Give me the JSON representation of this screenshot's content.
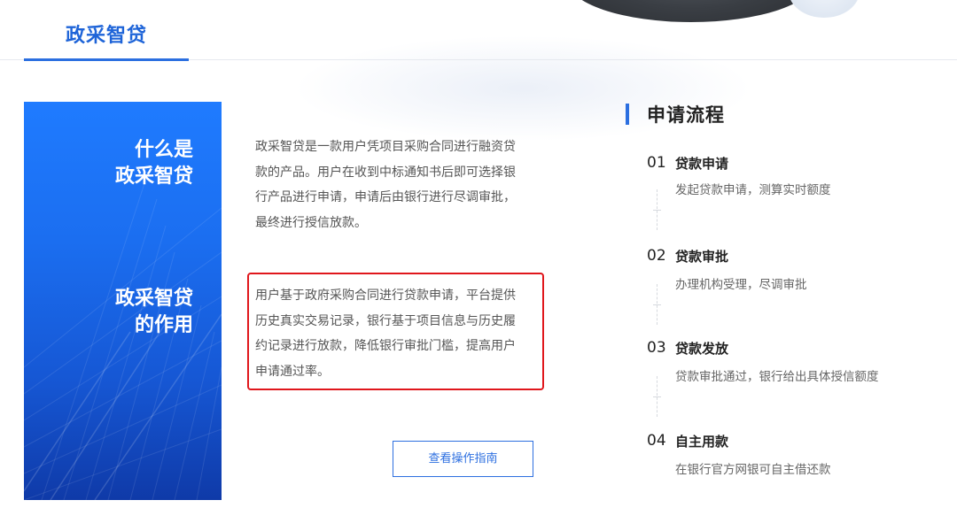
{
  "tabs": {
    "active_label": "政采智贷"
  },
  "side_panel": {
    "heading_1_line_1": "什么是",
    "heading_1_line_2": "政采智贷",
    "heading_2_line_1": "政采智贷",
    "heading_2_line_2": "的作用"
  },
  "intro": {
    "line_1": "政采智贷是一款用户凭项目采购合同进行融资贷",
    "line_2": "款的产品。用户在收到中标通知书后即可选择银",
    "line_3": "行产品进行申请，申请后由银行进行尽调审批，",
    "line_4": "最终进行授信放款。"
  },
  "function": {
    "line_1": "用户基于政府采购合同进行贷款申请，平台提供",
    "line_2": "历史真实交易记录，银行基于项目信息与历史履",
    "line_3": "约记录进行放款，降低银行审批门槛，提高用户",
    "line_4": "申请通过率。"
  },
  "guide_button": {
    "label": "查看操作指南"
  },
  "process": {
    "title": "申请流程",
    "steps": [
      {
        "num": "01",
        "title": "贷款申请",
        "desc": "发起贷款申请，测算实时额度"
      },
      {
        "num": "02",
        "title": "贷款审批",
        "desc": "办理机构受理，尽调审批"
      },
      {
        "num": "03",
        "title": "贷款发放",
        "desc": "贷款审批通过，银行给出具体授信额度"
      },
      {
        "num": "04",
        "title": "自主用款",
        "desc": "在银行官方网银可自主借还款"
      }
    ]
  },
  "colors": {
    "accent": "#2b6fe0",
    "panel_blue": "#1f7bff",
    "highlight_red": "#e0171c"
  }
}
